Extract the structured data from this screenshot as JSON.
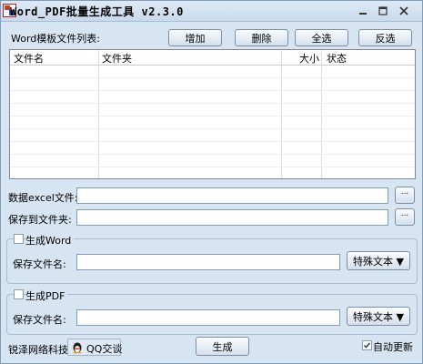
{
  "window": {
    "title": "Word_PDF批量生成工具 v2.3.0"
  },
  "file_list": {
    "label": "Word模板文件列表:",
    "buttons": {
      "add": "增加",
      "delete": "删除",
      "select_all": "全选",
      "invert": "反选"
    },
    "columns": [
      "文件名",
      "文件夹",
      "大小",
      "状态"
    ],
    "rows": []
  },
  "excel": {
    "label": "数据excel文件:",
    "value": "",
    "browse": "..."
  },
  "save_folder": {
    "label": "保存到文件夹:",
    "value": "",
    "browse": "..."
  },
  "word_section": {
    "checkbox_label": "生成Word",
    "checked": false,
    "save_name_label": "保存文件名:",
    "value": "",
    "special_text_button": "特殊文本 ▼"
  },
  "pdf_section": {
    "checkbox_label": "生成PDF",
    "checked": false,
    "save_name_label": "保存文件名:",
    "value": "",
    "special_text_button": "特殊文本 ▼"
  },
  "footer": {
    "brand": "锐泽网络科技",
    "qq_button": "QQ交谈",
    "generate_button": "生成",
    "auto_update_label": "自动更新",
    "auto_update_checked": true
  }
}
